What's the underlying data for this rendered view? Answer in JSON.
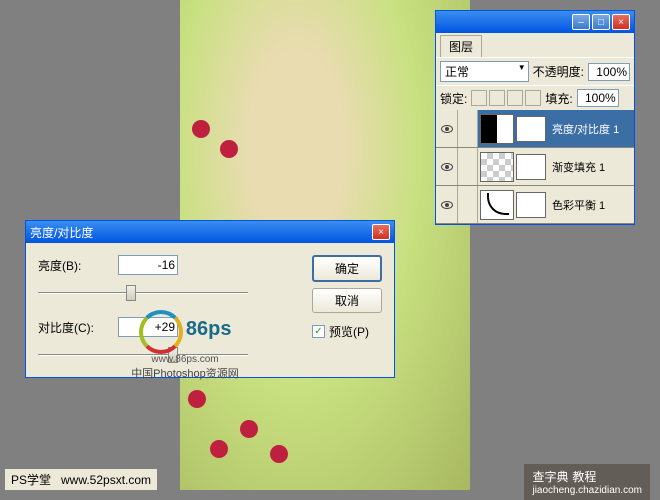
{
  "layers_panel": {
    "tab": "图层",
    "blend_mode": "正常",
    "opacity_label": "不透明度:",
    "opacity_value": "100%",
    "lock_label": "锁定:",
    "fill_label": "填充:",
    "fill_value": "100%",
    "items": [
      {
        "name": "亮度/对比度 1"
      },
      {
        "name": "渐变填充 1"
      },
      {
        "name": "色彩平衡 1"
      }
    ]
  },
  "dialog": {
    "title": "亮度/对比度",
    "brightness_label": "亮度(B):",
    "brightness_value": "-16",
    "contrast_label": "对比度(C):",
    "contrast_value": "+29",
    "ok": "确定",
    "cancel": "取消",
    "preview_label": "预览(P)"
  },
  "watermark": {
    "brand": "86ps",
    "url": "www.86ps.com",
    "desc": "中国Photoshop资源网"
  },
  "statusbar": {
    "left": "PS学堂",
    "url": "www.52psxt.com"
  },
  "footer": {
    "brand": "查字典",
    "label": "教程",
    "url": "jiaocheng.chazidian.com"
  }
}
